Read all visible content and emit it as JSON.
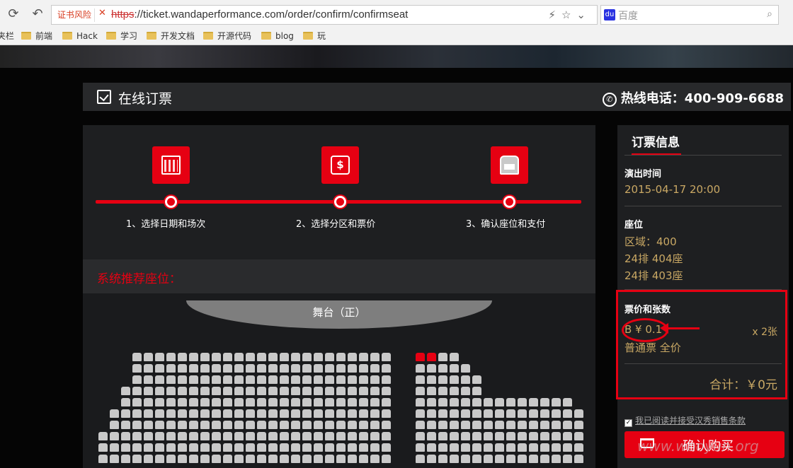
{
  "browser": {
    "cert_warning": "证书风险",
    "url_protocol": "https",
    "url_rest": "://ticket.wandaperformance.com/order/confirm/confirmseat",
    "search_placeholder": "百度",
    "bookmarks": [
      {
        "label": "夹栏",
        "icon": "none"
      },
      {
        "label": "前端",
        "icon": "folder-icon"
      },
      {
        "label": "Hack",
        "icon": "folder-icon"
      },
      {
        "label": "学习",
        "icon": "folder-icon"
      },
      {
        "label": "开发文档",
        "icon": "folder-icon"
      },
      {
        "label": "开源代码",
        "icon": "folder-icon"
      },
      {
        "label": "blog",
        "icon": "folder-icon"
      },
      {
        "label": "玩",
        "icon": "folder-icon"
      }
    ]
  },
  "header": {
    "title": "在线订票",
    "hotline": "热线电话：400-909-6688"
  },
  "steps": [
    {
      "label": "1、选择日期和场次",
      "icon": "calendar-icon"
    },
    {
      "label": "2、选择分区和票价",
      "icon": "cash-icon"
    },
    {
      "label": "3、确认座位和支付",
      "icon": "seat-icon"
    }
  ],
  "recommend": {
    "title": "系统推荐座位：",
    "stage": "舞台（正）"
  },
  "sidebar": {
    "heading": "订票信息",
    "show_time_label": "演出时间",
    "show_time": "2015-04-17 20:00",
    "seat_label": "座位",
    "zone": "区域：400",
    "seats": [
      "24排 404座",
      "24排 403座"
    ],
    "price_label": "票价和张数",
    "price": "B ¥ 0.1",
    "quantity": "x 2张",
    "ticket_type": "普通票 全价",
    "total": "合计：￥0元",
    "agree_text": "我已阅读并接受汉秀销售条款",
    "agree_checked": true,
    "buy_button": "确认购买"
  },
  "watermark": "www.wooyun.org",
  "colors": {
    "accent": "#e60012",
    "gold": "#c9a864"
  }
}
